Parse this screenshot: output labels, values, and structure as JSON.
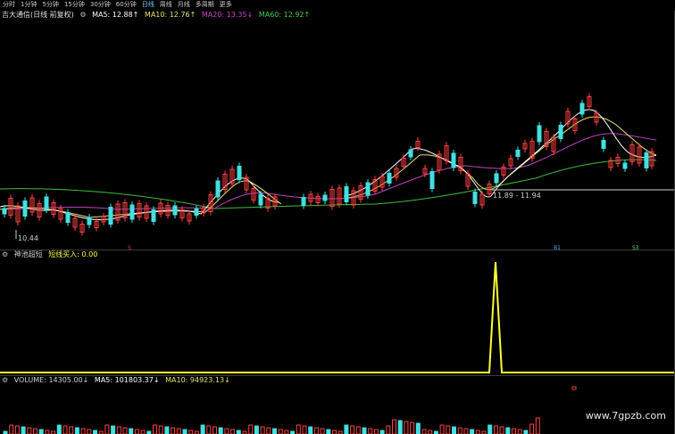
{
  "toolbar": {
    "tabs": [
      "分时",
      "1分钟",
      "5分钟",
      "15分钟",
      "30分钟",
      "60分钟",
      "日线",
      "周线",
      "月线",
      "多周期",
      "更多"
    ],
    "active_tab": "日线"
  },
  "main_panel": {
    "title": "吉大通信(日线 前复权)",
    "ma_labels": [
      {
        "text": "MA5: 12.88↑",
        "color": "#ffffff"
      },
      {
        "text": "MA10: 12.76↑",
        "color": "#e6e36a"
      },
      {
        "text": "MA20: 13.35↓",
        "color": "#cc44cc"
      },
      {
        "text": "MA60: 12.92↑",
        "color": "#44cc44"
      }
    ],
    "low_label": "10.44",
    "range_label": "11.89 - 11.94",
    "markers": [
      "S",
      "B1",
      "S3"
    ]
  },
  "indicator_panel": {
    "title": "神池超短",
    "series_label": "短线买入: 0.00",
    "series_color": "#ffff33"
  },
  "volume_panel": {
    "label": "VOLUME: 14305.00↓",
    "ma5": "MA5: 101803.37↓",
    "ma10": "MA10: 94923.13↓"
  },
  "watermark": "www.7gpzb.com"
}
